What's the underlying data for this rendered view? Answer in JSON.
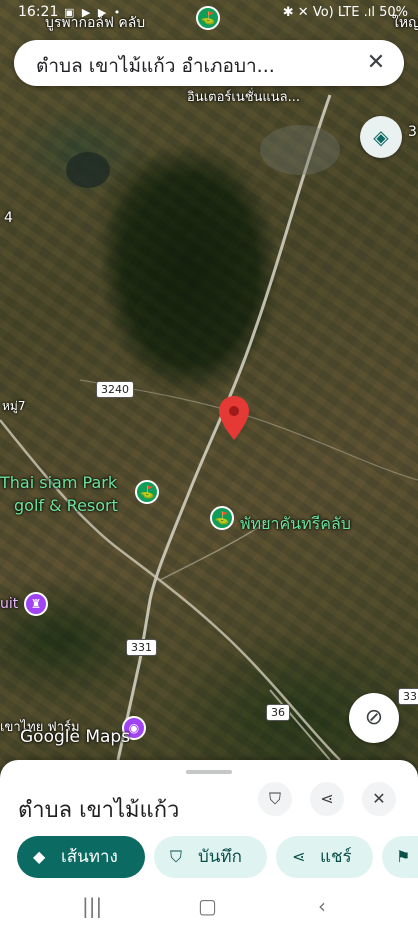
{
  "status_bar": {
    "time": "16:21",
    "notif_icons": "▣ ▶ ▶ •",
    "right_indicators": "✱ ✕ Vo) LTE .ıl",
    "battery": "50%"
  },
  "search_bar": {
    "title": "ตำบล เขาไม้แก้ว อำเภอบา...",
    "close_icon": "close-icon"
  },
  "map": {
    "labels": {
      "golf_club_top": "บูรพากอล์ฟ คลับ",
      "intl_top": "อินเตอร์เนชั่นแนล...",
      "town_right_top": "ใหญ่",
      "right_edge_3": "3",
      "left_edge_4": "4",
      "moo7": "หมู่7",
      "thai_siam_line1": "Thai siam Park",
      "thai_siam_line2": "golf & Resort",
      "pattaya_country_club": "พัทยาคันทรีคลับ",
      "uit": "uit",
      "bottom_left_partial": "เขาไทย ฟาร์ม",
      "right_edge_33": "33"
    },
    "road_shields": {
      "r3240": "3240",
      "r331": "331",
      "r36": "36"
    },
    "logo": "Google Maps",
    "accent_color": "#0b6b63",
    "pin_color": "#e53935"
  },
  "sheet": {
    "place_name": "ตำบล เขาไม้แก้ว",
    "actions": {
      "directions": "เส้นทาง",
      "save": "บันทึก",
      "share": "แชร์"
    }
  }
}
